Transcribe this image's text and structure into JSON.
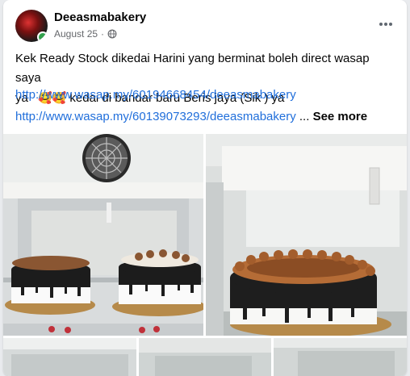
{
  "post": {
    "author": "Deeasmabakery",
    "date": "August 25",
    "date_separator": "·",
    "text_line1": "Kek Ready Stock dikedai Harini yang berminat boleh direct wasap saya",
    "text_line2_pre": "ya",
    "emojis": "🥰🥰",
    "text_line2_post": "kedai di bandar baru Beris jaya (Sik ) ya",
    "link1": "http://www.wasap.my/60194668454/deeasmabakery",
    "link2": "http://www.wasap.my/60139073293/deeasmabakery",
    "ellipsis": "...",
    "see_more": "See more"
  },
  "icons": {
    "more": "more-options-icon",
    "privacy": "globe-icon"
  },
  "colors": {
    "link": "#216fdb",
    "online": "#31a24c",
    "meta": "#65676b"
  }
}
